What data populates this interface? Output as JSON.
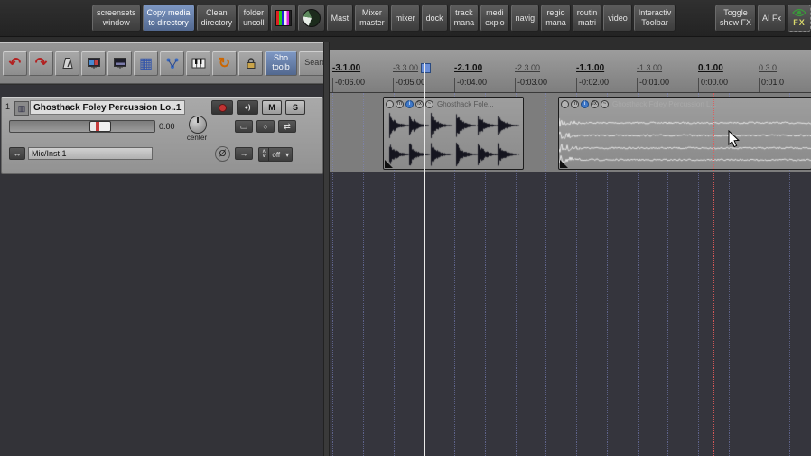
{
  "top_toolbar": {
    "screensets": "screensets\nwindow",
    "copy_media": "Copy media\nto directory",
    "clean_directory": "Clean\ndirectory",
    "folder_uncollapse": "folder\nuncoll",
    "master": "Mast",
    "mixer_master": "Mixer\nmaster",
    "mixer": "mixer",
    "dock": "dock",
    "track_manager": "track\nmana",
    "media_explorer": "medi\nexplo",
    "navigator": "navig",
    "region_manager": "regio\nmana",
    "routing_matrix": "routin\nmatri",
    "video": "video",
    "interactive_toolbar": "Interactiv\nToolbar",
    "toggle_show_fx": "Toggle\nshow FX",
    "ai_fx": "AI Fx",
    "fx_visibility": "FX"
  },
  "tool_row": {
    "show_toolbar": "Sho\ntoolb",
    "search": "Searc"
  },
  "icons": {
    "undo": "↶",
    "redo": "↷",
    "grid": "▦",
    "loop": "↻",
    "monitor": "●)",
    "mute": "M",
    "solo": "S",
    "io": "▭",
    "power": "○",
    "route": "⇄",
    "arrows": "↔",
    "phase": "Ø",
    "send": "→",
    "chevron_up": "∧",
    "chevron_down": "∨",
    "dropdown": "▾",
    "track_image": "▥"
  },
  "track": {
    "number": "1",
    "name": "Ghosthack Foley Percussion Lo..1",
    "volume_value": "0.00",
    "pan_label": "center",
    "input_value": "Mic/Inst 1",
    "automation_value": "off"
  },
  "ruler": {
    "measures": [
      "-3.1.00",
      "-3.3.00",
      "-2.1.00",
      "-2.3.00",
      "-1.1.00",
      "-1.3.00",
      "0.1.00",
      "0.3.0"
    ],
    "times": [
      "-0:06.00",
      "-0:05.00",
      "-0:04.00",
      "-0:03.00",
      "-0:02.00",
      "-0:01.00",
      "0:00.00",
      "0:01.0"
    ]
  },
  "items": [
    {
      "label": "Ghosthack Fole...",
      "buttons": [
        "",
        "m",
        "i",
        "fx",
        "~"
      ]
    },
    {
      "label": "Ghosthack Foley Percussion L...",
      "buttons": [
        "",
        "m",
        "i",
        "fx",
        "~"
      ]
    }
  ],
  "colors": {
    "accent_active": "#52688f",
    "item_info_blue": "#4079c9",
    "record_red": "#c23333",
    "edit_cursor": "#e9e9e9",
    "grid_blue": "#7d87c8",
    "marker_red": "#e15a5a"
  }
}
